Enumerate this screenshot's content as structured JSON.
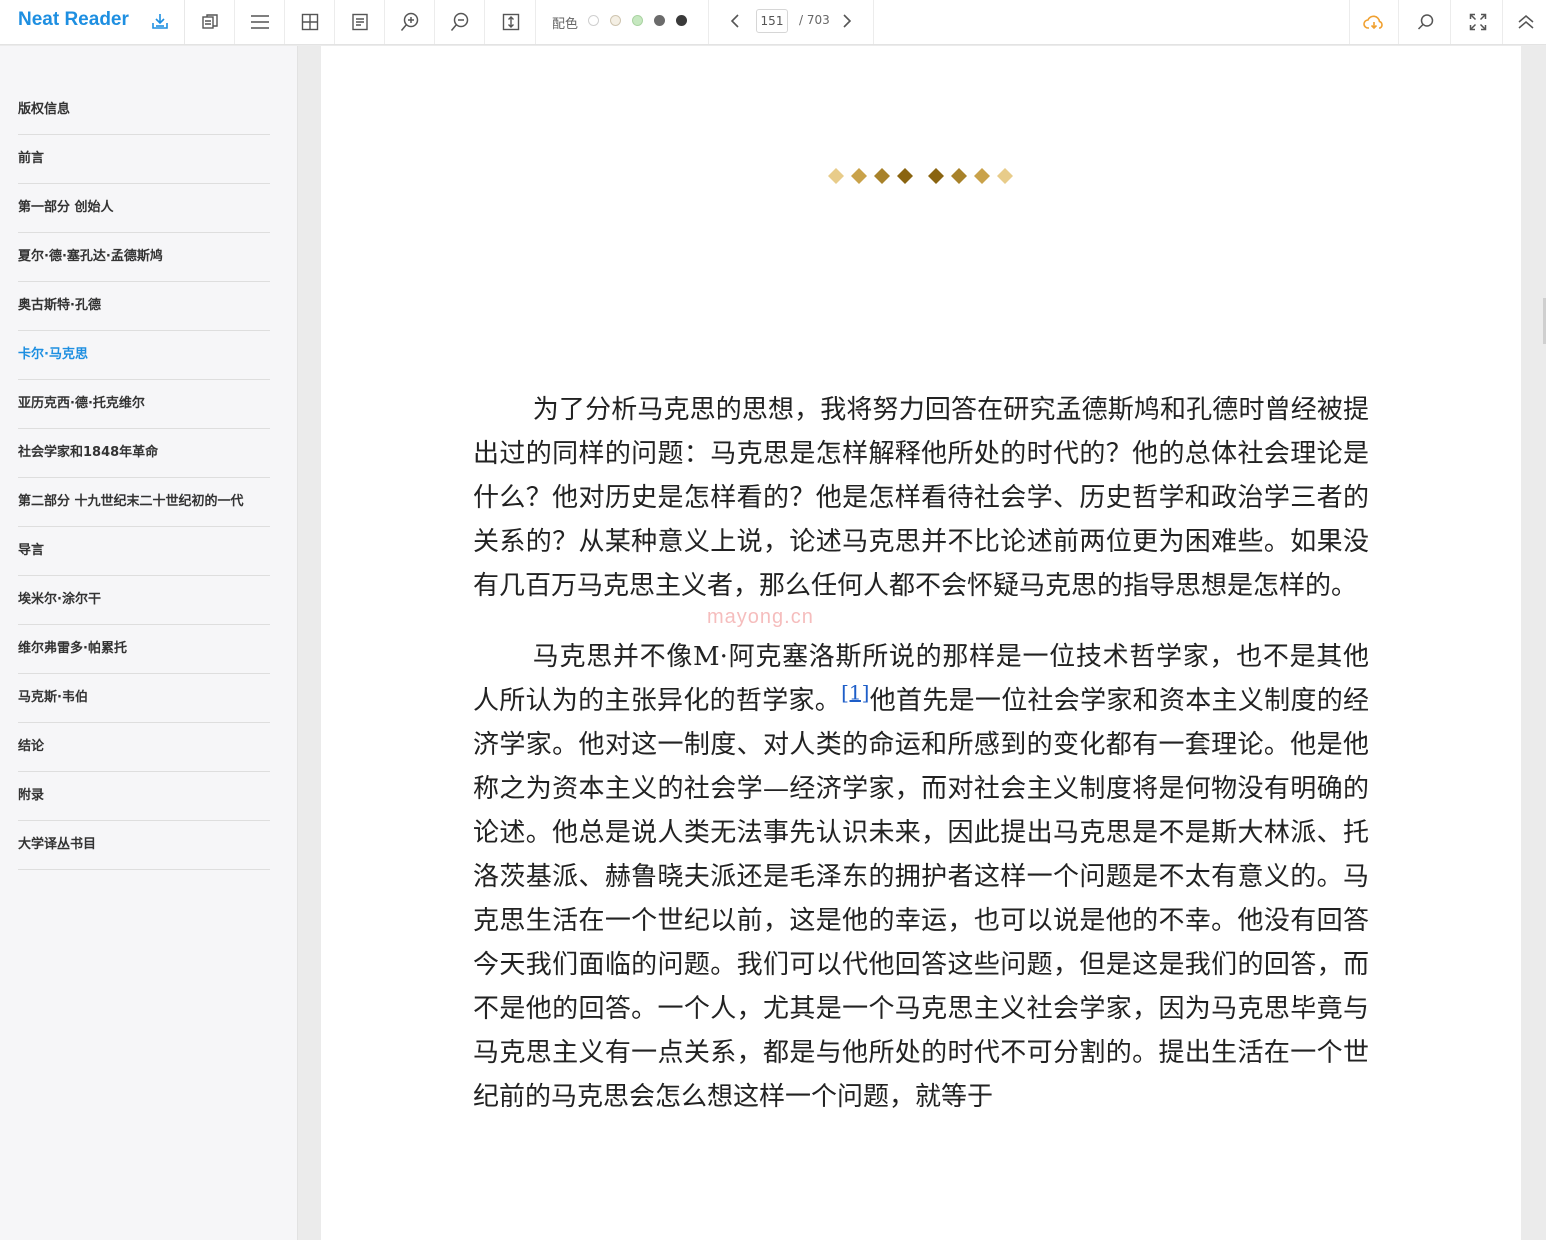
{
  "app": {
    "name": "Neat Reader"
  },
  "toolbar": {
    "theme_label": "配色",
    "theme_colors": [
      "#ffffff",
      "#f4efe4",
      "#c6e8c0",
      "#6b6b6b",
      "#3a3a3a"
    ],
    "page_current": "151",
    "page_total": "/ 703",
    "accent": "#1e8fe1",
    "sync_color": "#f0a030"
  },
  "sidebar": {
    "items": [
      {
        "label": "版权信息"
      },
      {
        "label": "前言"
      },
      {
        "label": "第一部分 创始人"
      },
      {
        "label": "夏尔·德·塞孔达·孟德斯鸠"
      },
      {
        "label": "奥古斯特·孔德"
      },
      {
        "label": "卡尔·马克思"
      },
      {
        "label": "亚历克西·德·托克维尔"
      },
      {
        "label": "社会学家和1848年革命"
      },
      {
        "label": "第二部分 十九世纪末二十世纪初的一代"
      },
      {
        "label": "导言"
      },
      {
        "label": "埃米尔·涂尔干"
      },
      {
        "label": "维尔弗雷多·帕累托"
      },
      {
        "label": "马克斯·韦伯"
      },
      {
        "label": "结论"
      },
      {
        "label": "附录"
      },
      {
        "label": "大学译丛书目"
      }
    ],
    "active_index": 5
  },
  "content": {
    "p1": "为了分析马克思的思想，我将努力回答在研究孟德斯鸠和孔德时曾经被提出过的同样的问题：马克思是怎样解释他所处的时代的？他的总体社会理论是什么？他对历史是怎样看的？他是怎样看待社会学、历史哲学和政治学三者的关系的？从某种意义上说，论述马克思并不比论述前两位更为困难些。如果没有几百万马克思主义者，那么任何人都不会怀疑马克思的指导思想是怎样的。",
    "p2_before": "马克思并不像M·阿克塞洛斯所说的那样是一位技术哲学家，也不是其他人所认为的主张异化的哲学家。",
    "p2_footnote": "[1]",
    "p2_after": "他首先是一位社会学家和资本主义制度的经济学家。他对这一制度、对人类的命运和所感到的变化都有一套理论。他是他称之为资本主义的社会学—经济学家，而对社会主义制度将是何物没有明确的论述。他总是说人类无法事先认识未来，因此提出马克思是不是斯大林派、托洛茨基派、赫鲁晓夫派还是毛泽东的拥护者这样一个问题是不太有意义的。马克思生活在一个世纪以前，这是他的幸运，也可以说是他的不幸。他没有回答今天我们面临的问题。我们可以代他回答这些问题，但是这是我们的回答，而不是他的回答。一个人，尤其是一个马克思主义社会学家，因为马克思毕竟与马克思主义有一点关系，都是与他所处的时代不可分割的。提出生活在一个世纪前的马克思会怎么想这样一个问题，就等于",
    "watermark": "mayong.cn",
    "ornament_colors": [
      "#e8cc8a",
      "#c9a24a",
      "#a8822a",
      "#8a6410"
    ]
  }
}
